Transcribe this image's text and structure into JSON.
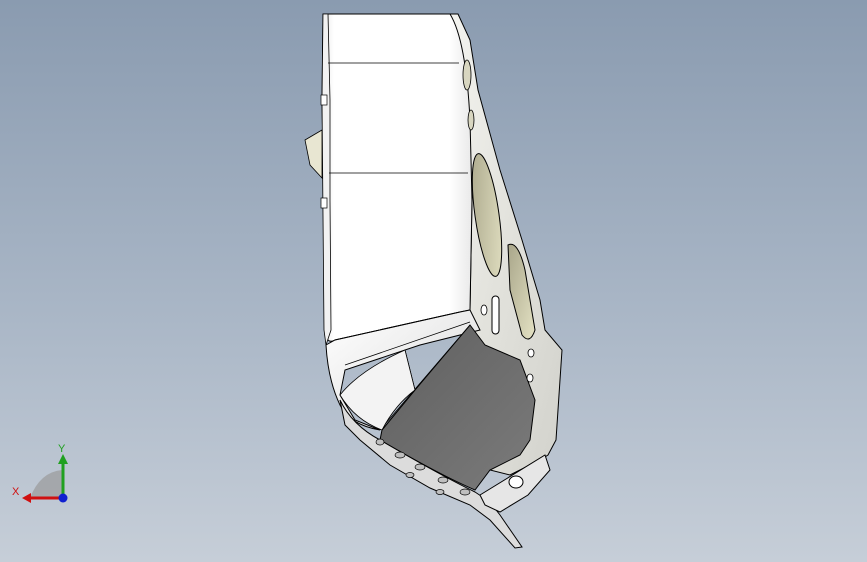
{
  "viewport": {
    "background_top": "#8a9bb0",
    "background_bottom": "#c6ced8"
  },
  "model": {
    "icon": "sheet-metal-bracket",
    "face_color": "#ffffff",
    "shadow_color": "#6b6b6b",
    "edge_color": "#000000"
  },
  "triad": {
    "x_label": "X",
    "y_label": "Y",
    "x_color": "#d01010",
    "y_color": "#20a020",
    "z_color": "#1020d0"
  }
}
